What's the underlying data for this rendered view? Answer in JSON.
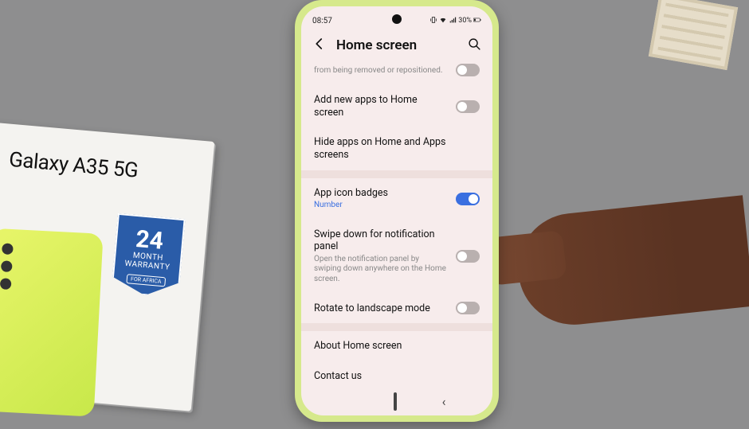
{
  "product_box": {
    "title": "Galaxy A35 5G",
    "badge_big": "24",
    "badge_mid": "MONTH",
    "badge_label": "WARRANTY",
    "badge_small": "FOR AFRICA"
  },
  "status_bar": {
    "time": "08:57",
    "battery": "30%"
  },
  "header": {
    "title": "Home screen"
  },
  "settings": {
    "lock_sub": "from being removed or repositioned.",
    "add_apps": "Add new apps to Home screen",
    "hide_apps": "Hide apps on Home and Apps screens",
    "badges_title": "App icon badges",
    "badges_sub": "Number",
    "swipe_title": "Swipe down for notification panel",
    "swipe_sub": "Open the notification panel by swiping down anywhere on the Home screen.",
    "rotate": "Rotate to landscape mode",
    "about": "About Home screen",
    "contact": "Contact us"
  }
}
